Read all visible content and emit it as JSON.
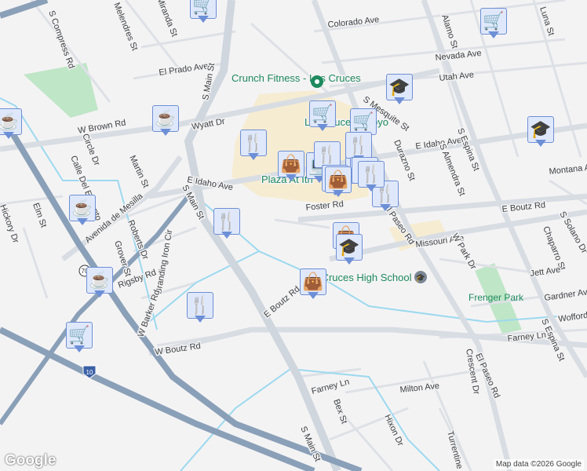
{
  "map": {
    "streets": [
      "S Compress Rd",
      "Melendres St",
      "Miranda St",
      "El Prado Ave",
      "W Brown Rd",
      "Wyatt Dr",
      "S Main St",
      "Colorado Ave",
      "Nevada Ave",
      "Utah Ave",
      "Alamo St",
      "Luna St",
      "S Mesquite St",
      "E Idaho Ave",
      "Durazno St",
      "S Almendra St",
      "S Espina St",
      "Montana Ave",
      "E Boutz Rd",
      "Foster Rd",
      "El Paseo Rd",
      "Missouri Ave",
      "Chaparro St",
      "S Solano Dr",
      "Jett Ave",
      "Gardner Ave",
      "Wofford",
      "Farney Ln",
      "Crescent Dr",
      "Milton Ave",
      "Bex St",
      "Hixon Dr",
      "Turrentine",
      "Circle Dr",
      "Martin St",
      "Calle Del Encanto",
      "E Idaho Ave",
      "Avenida de Mesilla",
      "Elm St",
      "Hickory Dr",
      "Roberts Dr",
      "Grover St",
      "Rigsby Rd",
      "Branding Iron Cir",
      "W Barker Rd",
      "W Boutz Rd",
      "S Main St",
      "E Boutz Rd",
      "S Main St",
      "Farney Ln",
      "El Paseo Rd",
      "W Park Dr",
      "S Espina St"
    ],
    "pois": [
      "Crunch Fitness - Las Cruces",
      "Las Cruces Arroyo",
      "Plaza At Ith",
      "Las Cruces High School",
      "Frenger Park"
    ],
    "shields": [
      "10",
      "70"
    ],
    "markers": [
      "shopping-cart",
      "shopping-cart",
      "graduation-cap",
      "coffee",
      "coffee",
      "shopping-cart",
      "restaurant",
      "shopping-cart",
      "graduation-cap",
      "coffee",
      "coffee",
      "shopping-cart",
      "restaurant",
      "shopping-bag",
      "restaurant",
      "laptop",
      "restaurant",
      "restaurant",
      "shopping-bag",
      "shopping-bag",
      "restaurant",
      "restaurant",
      "restaurant",
      "shopping-bag",
      "graduation-cap",
      "shopping-bag",
      "restaurant",
      "restaurant"
    ],
    "colors": {
      "marker_bg": "#dfe8fb",
      "marker_border": "#6d8fd6",
      "marker_icon": "#0f3e61",
      "highway": "#8aa0b8",
      "park": "#bfe6c7",
      "water": "#9cd9ef"
    }
  },
  "footer": {
    "logo": "Google",
    "attribution": "Map data ©2026 Google"
  }
}
